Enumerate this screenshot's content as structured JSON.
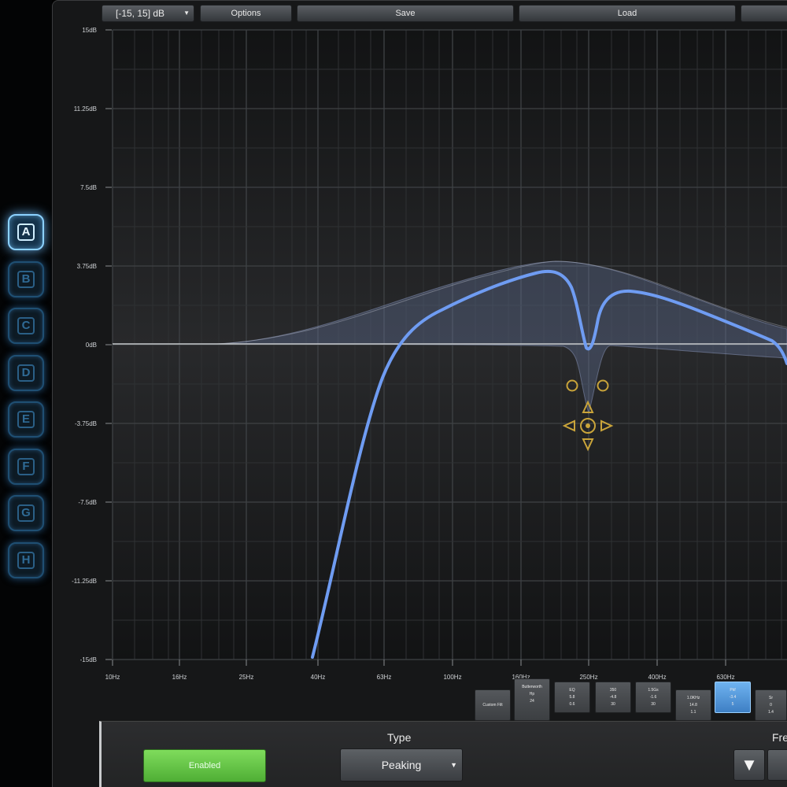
{
  "toolbar": {
    "range_label": "[-15, 15] dB",
    "options_label": "Options",
    "save_label": "Save",
    "load_label": "Load"
  },
  "channels": [
    "A",
    "B",
    "C",
    "D",
    "E",
    "F",
    "G",
    "H"
  ],
  "active_channel": "A",
  "graph": {
    "y_ticks": [
      "15dB",
      "11.25dB",
      "7.5dB",
      "3.75dB",
      "0dB",
      "-3.75dB",
      "-7.5dB",
      "-11.25dB",
      "-15dB"
    ],
    "x_ticks": [
      "10Hz",
      "16Hz",
      "25Hz",
      "40Hz",
      "63Hz",
      "100Hz",
      "160Hz",
      "250Hz",
      "400Hz",
      "630Hz"
    ],
    "y_range": [
      -15,
      15
    ],
    "curve_color": "#6f9cf2",
    "handle_color": "#c9a43a"
  },
  "bands": [
    {
      "lines": [
        "Custom Filt"
      ]
    },
    {
      "lines": [
        "Butterworth",
        "Hp",
        "24"
      ]
    },
    {
      "lines": [
        "EQ",
        "5.8",
        "0.6"
      ]
    },
    {
      "lines": [
        "350",
        "-4.8",
        "30"
      ]
    },
    {
      "lines": [
        "1.5Gs",
        "-1.6",
        "30"
      ]
    },
    {
      "lines": [
        "1.0KHz",
        "14.8",
        "1.1"
      ]
    },
    {
      "lines": [
        "Pkf",
        "-3.4",
        "5"
      ],
      "active": true
    },
    {
      "lines": [
        "Sr",
        "0",
        "1.4"
      ]
    }
  ],
  "bottom": {
    "enabled_label": "Enabled",
    "type_label": "Type",
    "type_value": "Peaking",
    "freq_label": "Fre",
    "freq_down_symbol": "▼"
  }
}
